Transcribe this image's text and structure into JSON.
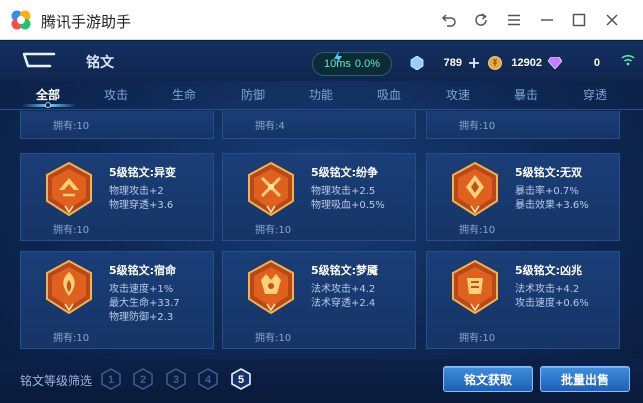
{
  "window": {
    "title": "腾讯手游助手",
    "controls": [
      "back-icon",
      "refresh-icon",
      "menu-icon",
      "minimize-icon",
      "maximize-icon",
      "close-icon"
    ]
  },
  "header": {
    "page_title": "铭文",
    "latency": "10ms",
    "packet_loss": "0.0%",
    "diamonds": "789",
    "gold": "12902",
    "gems": "0"
  },
  "tabs": [
    {
      "label": "全部",
      "active": true
    },
    {
      "label": "攻击",
      "active": false
    },
    {
      "label": "生命",
      "active": false
    },
    {
      "label": "防御",
      "active": false
    },
    {
      "label": "功能",
      "active": false
    },
    {
      "label": "吸血",
      "active": false
    },
    {
      "label": "攻速",
      "active": false
    },
    {
      "label": "暴击",
      "active": false
    },
    {
      "label": "穿透",
      "active": false
    }
  ],
  "cards_partial": [
    {
      "owned": "拥有:10"
    },
    {
      "owned": "拥有:4"
    },
    {
      "owned": "拥有:10"
    }
  ],
  "cards": [
    {
      "name": "5级铭文:异变",
      "stats": [
        "物理攻击+2",
        "物理穿透+3.6"
      ],
      "owned": "拥有:10"
    },
    {
      "name": "5级铭文:纷争",
      "stats": [
        "物理攻击+2.5",
        "物理吸血+0.5%"
      ],
      "owned": "拥有:10"
    },
    {
      "name": "5级铭文:无双",
      "stats": [
        "暴击率+0.7%",
        "暴击效果+3.6%"
      ],
      "owned": "拥有:10"
    },
    {
      "name": "5级铭文:宿命",
      "stats": [
        "攻击速度+1%",
        "最大生命+33.7",
        "物理防御+2.3"
      ],
      "owned": "拥有:10"
    },
    {
      "name": "5级铭文:梦魇",
      "stats": [
        "法术攻击+4.2",
        "法术穿透+2.4"
      ],
      "owned": "拥有:10"
    },
    {
      "name": "5级铭文:凶兆",
      "stats": [
        "法术攻击+4.2",
        "攻击速度+0.6%"
      ],
      "owned": "拥有:10"
    }
  ],
  "footer": {
    "filter_label": "铭文等级筛选",
    "levels": [
      "1",
      "2",
      "3",
      "4",
      "5"
    ],
    "selected_level": "5",
    "acquire_button": "铭文获取",
    "bulk_sell_button": "批量出售"
  },
  "colors": {
    "accent": "#3e8ee0",
    "emblem_orange": "#e0601e",
    "emblem_gold": "#f3b24a",
    "network_green": "#58f0a6"
  }
}
